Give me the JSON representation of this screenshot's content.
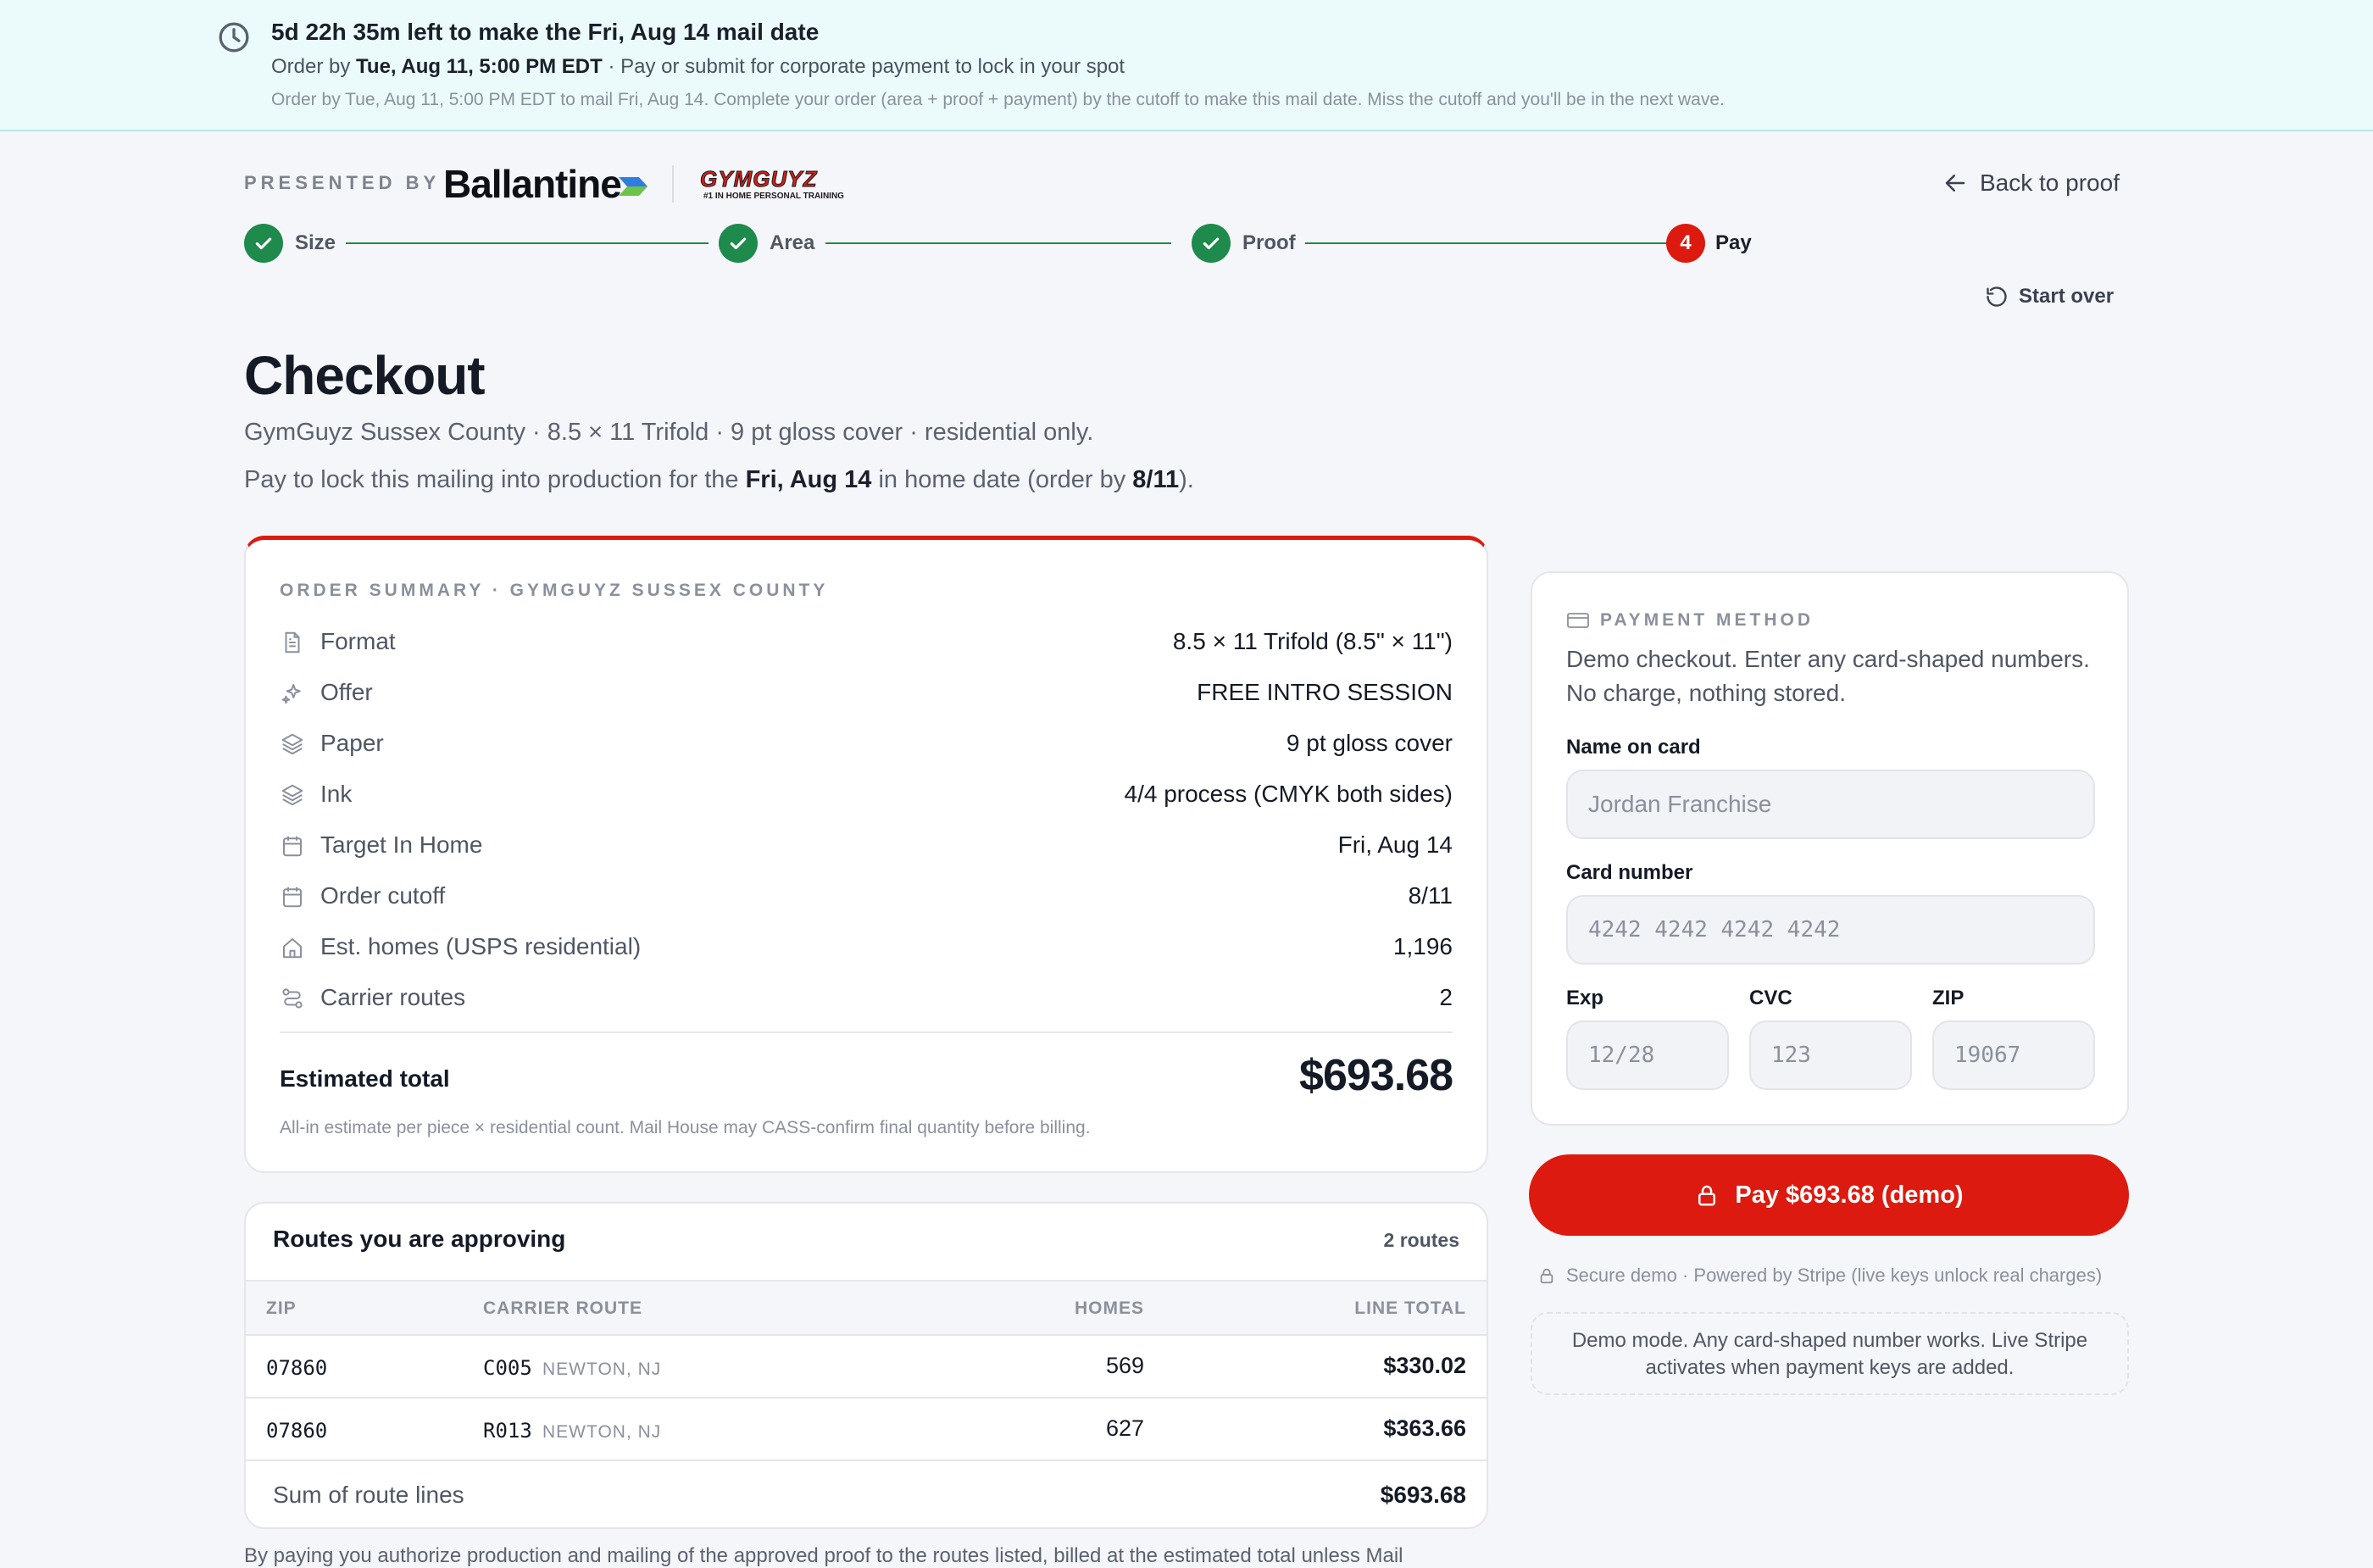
{
  "banner": {
    "title": "5d 22h 35m left to make the Fri, Aug 14 mail date",
    "line2_prefix": "Order by",
    "line2_bold": "Tue, Aug 11, 5:00 PM EDT",
    "line2_suffix": "· Pay or submit for corporate payment to lock in your spot",
    "line3": "Order by Tue, Aug 11, 5:00 PM EDT to mail Fri, Aug 14. Complete your order (area + proof + payment) by the cutoff to make this mail date. Miss the cutoff and you'll be in the next wave."
  },
  "header": {
    "presented_by": "PRESENTED BY",
    "brand": "Ballantine",
    "partner_logo_text": "GYMGUYZ",
    "partner_tagline": "#1 IN HOME PERSONAL TRAINING",
    "back_link": "Back to proof",
    "start_over": "Start over"
  },
  "stepper": [
    {
      "label": "Size",
      "state": "done"
    },
    {
      "label": "Area",
      "state": "done"
    },
    {
      "label": "Proof",
      "state": "done"
    },
    {
      "label": "Pay",
      "state": "current",
      "number": "4"
    }
  ],
  "page": {
    "title": "Checkout",
    "subtitle": "GymGuyz Sussex County · 8.5 × 11 Trifold · 9 pt gloss cover · residential only.",
    "lock_prefix": "Pay to lock this mailing into production for the",
    "lock_date": "Fri, Aug 14",
    "lock_middle": "in home date (order by",
    "lock_cutoff": "8/11",
    "lock_suffix": ")."
  },
  "summary": {
    "eyebrow": "ORDER SUMMARY · GYMGUYZ SUSSEX COUNTY",
    "rows": [
      {
        "icon": "document-icon",
        "label": "Format",
        "value": "8.5 × 11 Trifold (8.5\" × 11\")"
      },
      {
        "icon": "sparkle-icon",
        "label": "Offer",
        "value": "FREE INTRO SESSION"
      },
      {
        "icon": "layers-icon",
        "label": "Paper",
        "value": "9 pt gloss cover"
      },
      {
        "icon": "layers-icon",
        "label": "Ink",
        "value": "4/4 process (CMYK both sides)"
      },
      {
        "icon": "calendar-icon",
        "label": "Target In Home",
        "value": "Fri, Aug 14"
      },
      {
        "icon": "calendar-icon",
        "label": "Order cutoff",
        "value": "8/11"
      },
      {
        "icon": "home-icon",
        "label": "Est. homes (USPS residential)",
        "value": "1,196"
      },
      {
        "icon": "route-icon",
        "label": "Carrier routes",
        "value": "2"
      }
    ],
    "estimated_label": "Estimated total",
    "estimated_total": "$693.68",
    "note": "All-in estimate per piece × residential count. Mail House may CASS-confirm final quantity before billing."
  },
  "routes": {
    "title": "Routes you are approving",
    "count": "2 routes",
    "columns": [
      "ZIP",
      "CARRIER ROUTE",
      "HOMES",
      "LINE TOTAL"
    ],
    "rows": [
      {
        "zip": "07860",
        "route": "C005",
        "city": "NEWTON, NJ",
        "homes": "569",
        "total": "$330.02"
      },
      {
        "zip": "07860",
        "route": "R013",
        "city": "NEWTON, NJ",
        "homes": "627",
        "total": "$363.66"
      }
    ],
    "sum_label": "Sum of route lines",
    "sum_value": "$693.68"
  },
  "footnote": "By paying you authorize production and mailing of the approved proof to the routes listed, billed at the estimated total unless Mail",
  "payment": {
    "eyebrow": "PAYMENT METHOD",
    "description": "Demo checkout. Enter any card-shaped numbers. No charge, nothing stored.",
    "name_label": "Name on card",
    "name_placeholder": "Jordan Franchise",
    "card_label": "Card number",
    "card_placeholder": "4242 4242 4242 4242",
    "exp_label": "Exp",
    "exp_placeholder": "12/28",
    "cvc_label": "CVC",
    "cvc_placeholder": "123",
    "zip_label": "ZIP",
    "zip_placeholder": "19067",
    "pay_button": "Pay $693.68 (demo)",
    "secure_note": "Secure demo · Powered by Stripe (live keys unlock real charges)",
    "demo_mode": "Demo mode. Any card-shaped number works. Live Stripe activates when payment keys are added."
  },
  "colors": {
    "accent": "#dd1a0f",
    "success": "#1e8a4b",
    "banner_bg": "#ebfbfc"
  }
}
